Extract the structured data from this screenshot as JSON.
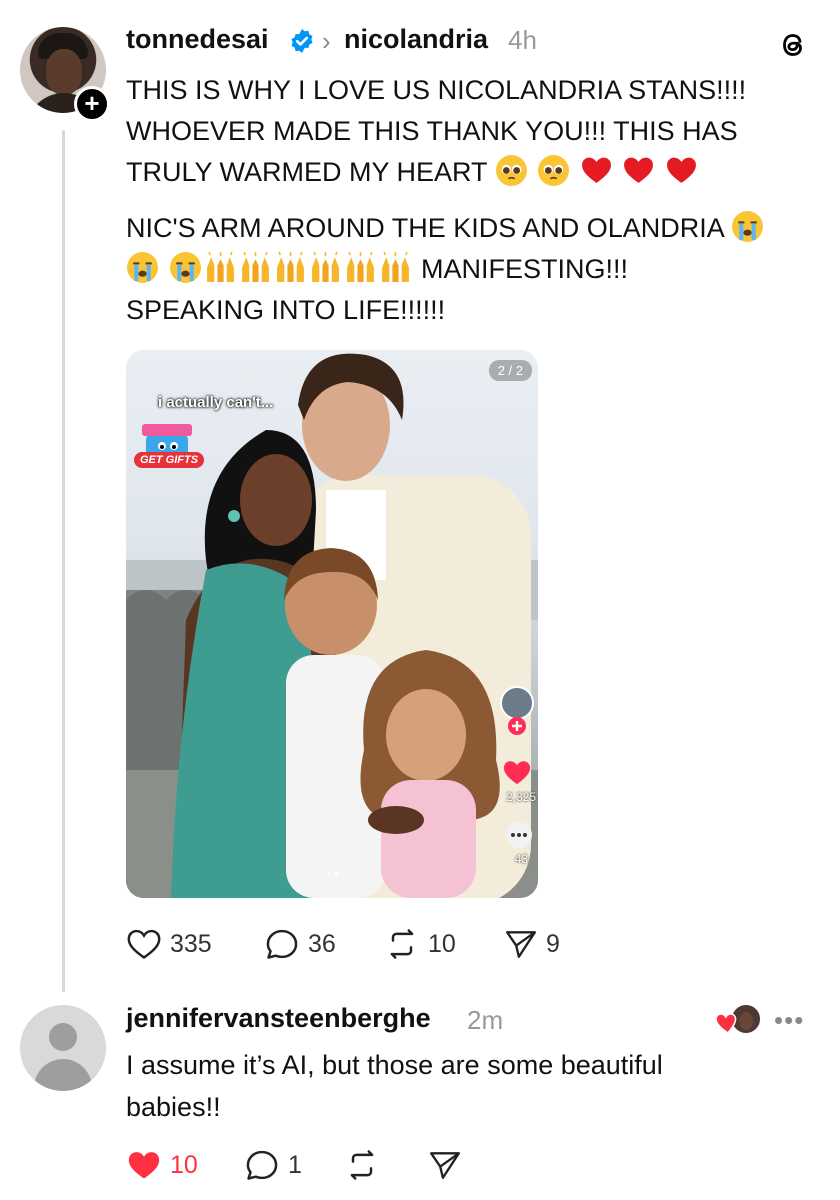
{
  "post": {
    "username": "tonnedesai",
    "verified": true,
    "reply_to": "nicolandria",
    "time": "4h",
    "paragraph1_line1": "THIS IS WHY I LOVE US NICOLANDRIA STANS!!!!",
    "paragraph1_line2": "WHOEVER MADE THIS THANK YOU!!! THIS HAS",
    "paragraph1_line3": "TRULY WARMED MY HEART",
    "paragraph2_line1": "NIC'S ARM AROUND THE KIDS AND OLANDRIA",
    "paragraph2_line2_text": "MANIFESTING!!!",
    "paragraph2_line3": "SPEAKING INTO LIFE!!!!!!",
    "emoji_line1": [
      "pleading-face",
      "pleading-face",
      "red-heart",
      "red-heart",
      "red-heart"
    ],
    "emoji_line2_end": [
      "loudly-crying-face"
    ],
    "emoji_line2_start": [
      "loudly-crying-face",
      "loudly-crying-face",
      "raising-hands",
      "raising-hands",
      "raising-hands",
      "raising-hands",
      "raising-hands",
      "raising-hands"
    ],
    "media": {
      "page_indicator": "2 / 2",
      "overlay_caption": "i actually can't...",
      "gift_label": "GET GIFTS",
      "like_count": "2,325",
      "comment_count": "43"
    },
    "actions": {
      "likes": "335",
      "comments": "36",
      "reposts": "10",
      "shares": "9"
    }
  },
  "reply": {
    "username": "jennifervansteenberghe",
    "time": "2m",
    "text_line1": "I assume it’s AI, but those are some beautiful",
    "text_line2": "babies!!",
    "more_label": "•••",
    "actions": {
      "likes": "10",
      "comments": "1"
    }
  },
  "colors": {
    "like_red": "#ff3040",
    "verified_blue": "#0095f6",
    "muted_text": "#999999"
  }
}
